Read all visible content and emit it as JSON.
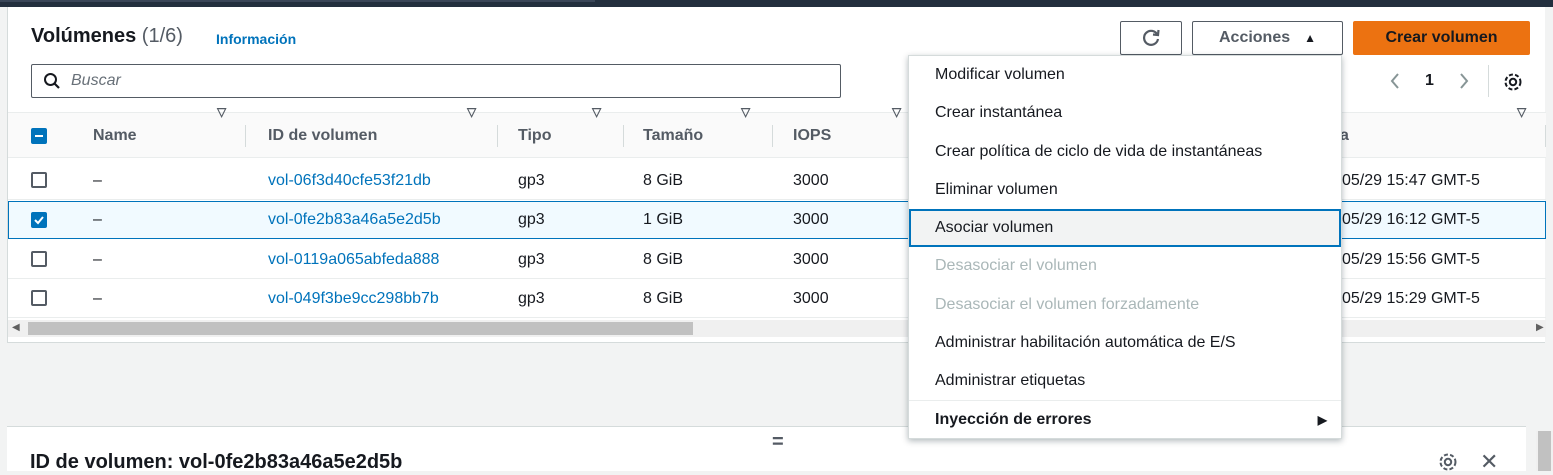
{
  "header": {
    "title": "Volúmenes",
    "count": "(1/6)",
    "info_link": "Información",
    "actions_label": "Acciones",
    "create_label": "Crear volumen"
  },
  "search": {
    "placeholder": "Buscar",
    "value": ""
  },
  "pagination": {
    "page": "1"
  },
  "table": {
    "columns": [
      "Name",
      "ID de volumen",
      "Tipo",
      "Tamaño",
      "IOPS",
      "a"
    ],
    "rows": [
      {
        "name": "–",
        "id": "vol-06f3d40cfe53f21db",
        "type": "gp3",
        "size": "8 GiB",
        "iops": "3000",
        "created": "05/29 15:47 GMT-5",
        "selected": false
      },
      {
        "name": "–",
        "id": "vol-0fe2b83a46a5e2d5b",
        "type": "gp3",
        "size": "1 GiB",
        "iops": "3000",
        "created": "05/29 16:12 GMT-5",
        "selected": true
      },
      {
        "name": "–",
        "id": "vol-0119a065abfeda888",
        "type": "gp3",
        "size": "8 GiB",
        "iops": "3000",
        "created": "05/29 15:56 GMT-5",
        "selected": false
      },
      {
        "name": "–",
        "id": "vol-049f3be9cc298bb7b",
        "type": "gp3",
        "size": "8 GiB",
        "iops": "3000",
        "created": "05/29 15:29 GMT-5",
        "selected": false
      }
    ]
  },
  "actions_menu": {
    "items": [
      {
        "label": "Modificar volumen",
        "state": "enabled"
      },
      {
        "label": "Crear instantánea",
        "state": "enabled"
      },
      {
        "label": "Crear política de ciclo de vida de instantáneas",
        "state": "enabled"
      },
      {
        "label": "Eliminar volumen",
        "state": "enabled"
      },
      {
        "label": "Asociar volumen",
        "state": "highlighted"
      },
      {
        "label": "Desasociar el volumen",
        "state": "disabled"
      },
      {
        "label": "Desasociar el volumen forzadamente",
        "state": "disabled"
      },
      {
        "label": "Administrar habilitación automática de E/S",
        "state": "enabled"
      },
      {
        "label": "Administrar etiquetas",
        "state": "enabled"
      },
      {
        "label": "Inyección de errores",
        "state": "submenu"
      }
    ]
  },
  "detail": {
    "title": "ID de volumen: vol-0fe2b83a46a5e2d5b",
    "handle": "="
  },
  "colors": {
    "accent": "#0073bb",
    "primary_button": "#ec7211",
    "header_bar": "#232f3e"
  }
}
